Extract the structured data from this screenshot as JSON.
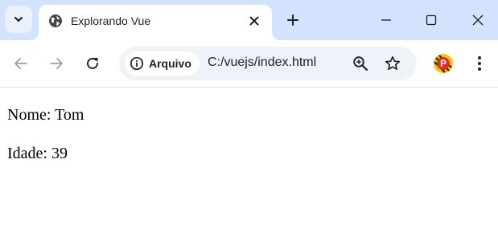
{
  "tab": {
    "title": "Explorando Vue"
  },
  "address_bar": {
    "security_chip": "Arquivo",
    "url": "C:/vuejs/index.html"
  },
  "profile": {
    "initial": "P"
  },
  "page": {
    "lines": [
      "Nome: Tom",
      "Idade: 39"
    ]
  },
  "icons": {
    "tab_search": "chevron-down-icon",
    "favicon": "globe-icon",
    "close": "close-icon",
    "new_tab": "plus-icon",
    "minimize": "minimize-icon",
    "maximize": "maximize-icon",
    "window_close": "close-icon",
    "back": "arrow-left-icon",
    "forward": "arrow-right-icon",
    "reload": "reload-icon",
    "info": "info-icon",
    "zoom": "zoom-in-icon",
    "bookmark": "star-icon",
    "menu": "kebab-menu-icon"
  },
  "colors": {
    "tabbar": "#d3e3fd",
    "omnibox": "#eef2f9",
    "profile_ring": "#f4c20d",
    "profile_fill": "#d93025"
  }
}
